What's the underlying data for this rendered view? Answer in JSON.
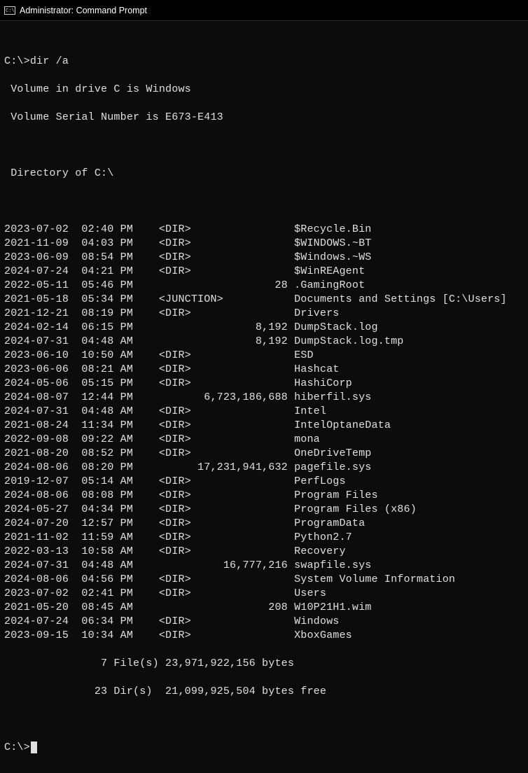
{
  "window": {
    "title": "Administrator: Command Prompt"
  },
  "prompt": {
    "path": "C:\\>",
    "command": "dir /a"
  },
  "header": {
    "volume_line": " Volume in drive C is Windows",
    "serial_line": " Volume Serial Number is E673-E413",
    "dir_of_line": " Directory of C:\\"
  },
  "entries": [
    {
      "date": "2023-07-02",
      "time": "02:40 PM",
      "type": "<DIR>",
      "size": "",
      "name": "$Recycle.Bin"
    },
    {
      "date": "2021-11-09",
      "time": "04:03 PM",
      "type": "<DIR>",
      "size": "",
      "name": "$WINDOWS.~BT"
    },
    {
      "date": "2023-06-09",
      "time": "08:54 PM",
      "type": "<DIR>",
      "size": "",
      "name": "$Windows.~WS"
    },
    {
      "date": "2024-07-24",
      "time": "04:21 PM",
      "type": "<DIR>",
      "size": "",
      "name": "$WinREAgent"
    },
    {
      "date": "2022-05-11",
      "time": "05:46 PM",
      "type": "",
      "size": "28",
      "name": ".GamingRoot"
    },
    {
      "date": "2021-05-18",
      "time": "05:34 PM",
      "type": "<JUNCTION>",
      "size": "",
      "name": "Documents and Settings [C:\\Users]"
    },
    {
      "date": "2021-12-21",
      "time": "08:19 PM",
      "type": "<DIR>",
      "size": "",
      "name": "Drivers"
    },
    {
      "date": "2024-02-14",
      "time": "06:15 PM",
      "type": "",
      "size": "8,192",
      "name": "DumpStack.log"
    },
    {
      "date": "2024-07-31",
      "time": "04:48 AM",
      "type": "",
      "size": "8,192",
      "name": "DumpStack.log.tmp"
    },
    {
      "date": "2023-06-10",
      "time": "10:50 AM",
      "type": "<DIR>",
      "size": "",
      "name": "ESD"
    },
    {
      "date": "2023-06-06",
      "time": "08:21 AM",
      "type": "<DIR>",
      "size": "",
      "name": "Hashcat"
    },
    {
      "date": "2024-05-06",
      "time": "05:15 PM",
      "type": "<DIR>",
      "size": "",
      "name": "HashiCorp"
    },
    {
      "date": "2024-08-07",
      "time": "12:44 PM",
      "type": "",
      "size": "6,723,186,688",
      "name": "hiberfil.sys"
    },
    {
      "date": "2024-07-31",
      "time": "04:48 AM",
      "type": "<DIR>",
      "size": "",
      "name": "Intel"
    },
    {
      "date": "2021-08-24",
      "time": "11:34 PM",
      "type": "<DIR>",
      "size": "",
      "name": "IntelOptaneData"
    },
    {
      "date": "2022-09-08",
      "time": "09:22 AM",
      "type": "<DIR>",
      "size": "",
      "name": "mona"
    },
    {
      "date": "2021-08-20",
      "time": "08:52 PM",
      "type": "<DIR>",
      "size": "",
      "name": "OneDriveTemp"
    },
    {
      "date": "2024-08-06",
      "time": "08:20 PM",
      "type": "",
      "size": "17,231,941,632",
      "name": "pagefile.sys"
    },
    {
      "date": "2019-12-07",
      "time": "05:14 AM",
      "type": "<DIR>",
      "size": "",
      "name": "PerfLogs"
    },
    {
      "date": "2024-08-06",
      "time": "08:08 PM",
      "type": "<DIR>",
      "size": "",
      "name": "Program Files"
    },
    {
      "date": "2024-05-27",
      "time": "04:34 PM",
      "type": "<DIR>",
      "size": "",
      "name": "Program Files (x86)"
    },
    {
      "date": "2024-07-20",
      "time": "12:57 PM",
      "type": "<DIR>",
      "size": "",
      "name": "ProgramData"
    },
    {
      "date": "2021-11-02",
      "time": "11:59 AM",
      "type": "<DIR>",
      "size": "",
      "name": "Python2.7"
    },
    {
      "date": "2022-03-13",
      "time": "10:58 AM",
      "type": "<DIR>",
      "size": "",
      "name": "Recovery"
    },
    {
      "date": "2024-07-31",
      "time": "04:48 AM",
      "type": "",
      "size": "16,777,216",
      "name": "swapfile.sys"
    },
    {
      "date": "2024-08-06",
      "time": "04:56 PM",
      "type": "<DIR>",
      "size": "",
      "name": "System Volume Information"
    },
    {
      "date": "2023-07-02",
      "time": "02:41 PM",
      "type": "<DIR>",
      "size": "",
      "name": "Users"
    },
    {
      "date": "2021-05-20",
      "time": "08:45 AM",
      "type": "",
      "size": "208",
      "name": "W10P21H1.wim"
    },
    {
      "date": "2024-07-24",
      "time": "06:34 PM",
      "type": "<DIR>",
      "size": "",
      "name": "Windows"
    },
    {
      "date": "2023-09-15",
      "time": "10:34 AM",
      "type": "<DIR>",
      "size": "",
      "name": "XboxGames"
    }
  ],
  "summary": {
    "files_line": "               7 File(s) 23,971,922,156 bytes",
    "dirs_line": "              23 Dir(s)  21,099,925,504 bytes free"
  },
  "final_prompt": "C:\\>"
}
